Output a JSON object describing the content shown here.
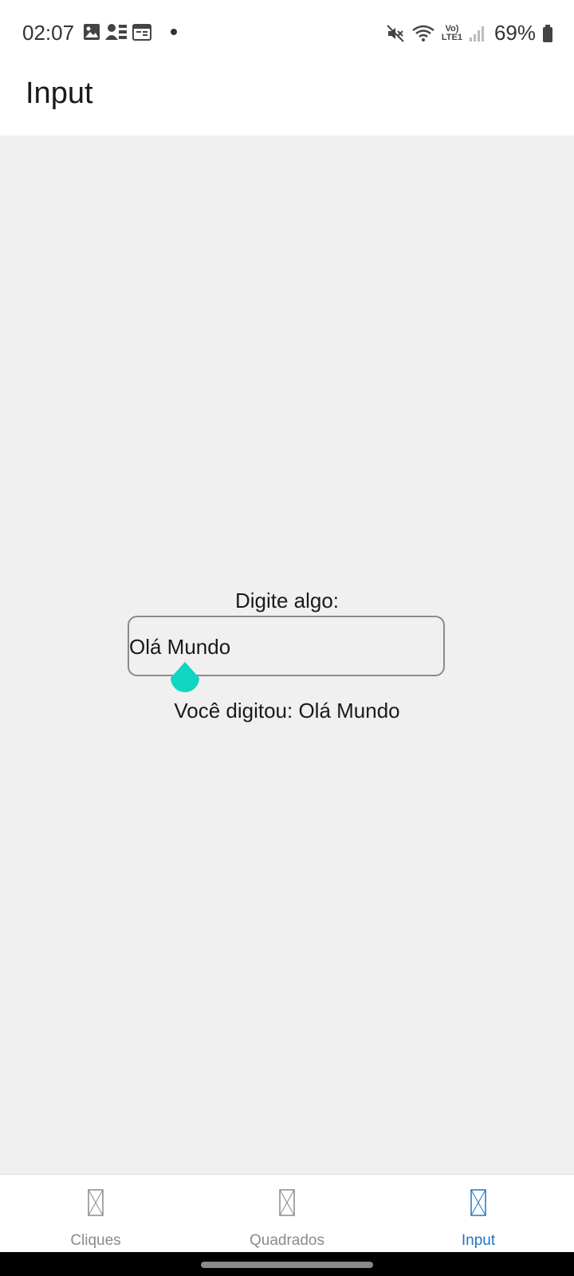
{
  "status_bar": {
    "time": "02:07",
    "battery": "69%",
    "network_label": "LTE1",
    "left_icons": [
      "gallery-icon",
      "contacts-icon",
      "calendar-icon",
      "dot-icon"
    ],
    "right_icons": [
      "mute-icon",
      "wifi-icon",
      "volte-icon",
      "signal-icon",
      "battery-icon"
    ]
  },
  "app_bar": {
    "title": "Input"
  },
  "main": {
    "prompt_label": "Digite algo:",
    "input_value": "Olá Mundo",
    "result_text": "Você digitou: Olá Mundo",
    "cursor_color": "#0fd6c0"
  },
  "bottom_nav": {
    "items": [
      {
        "label": "Cliques",
        "active": false
      },
      {
        "label": "Quadrados",
        "active": false
      },
      {
        "label": "Input",
        "active": true
      }
    ],
    "active_color": "#2175c4",
    "inactive_color": "#8a8a8a"
  }
}
